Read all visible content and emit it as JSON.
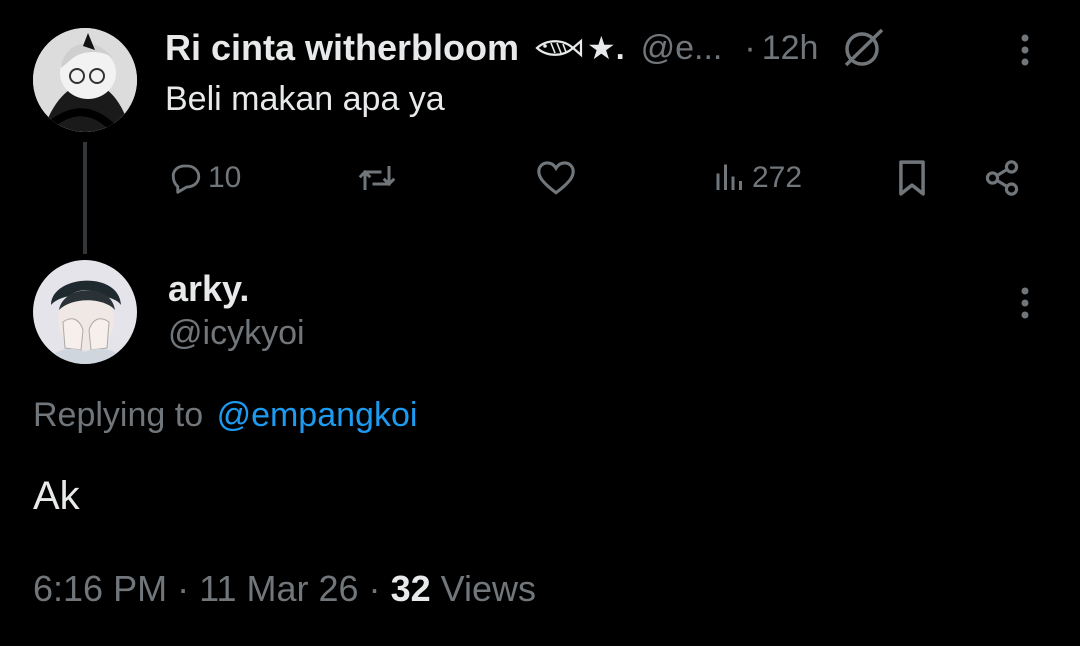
{
  "parent_tweet": {
    "display_name": "Ri cinta witherbloom",
    "name_emoji": "★.",
    "handle_truncated": "@e...",
    "time_sep": "·",
    "time": "12h",
    "text": "Beli makan apa ya",
    "stats": {
      "replies": "10",
      "views": "272"
    }
  },
  "reply_tweet": {
    "display_name": "arky.",
    "handle": "@icykyoi",
    "replying_prefix": "Replying to",
    "replying_handle": "@empangkoi",
    "text": "Ak",
    "timestamp": {
      "time": "6:16 PM",
      "sep1": "·",
      "date": "11 Mar 26",
      "sep2": "·",
      "views_count": "32",
      "views_label": "Views"
    }
  },
  "colors": {
    "background": "#000000",
    "text_primary": "#e7e9ea",
    "text_secondary": "#71767b",
    "link": "#1d9bf0"
  }
}
